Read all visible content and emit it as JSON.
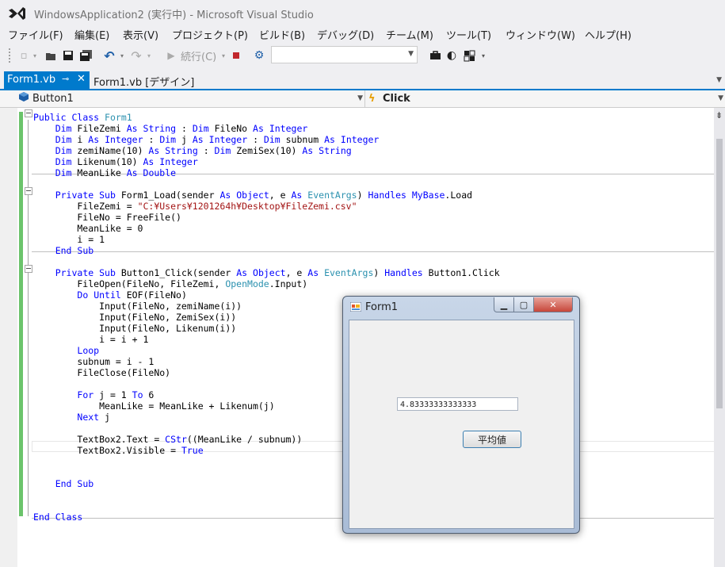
{
  "window": {
    "title": "WindowsApplication2 (実行中) - Microsoft Visual Studio"
  },
  "menu": [
    "ファイル(F)",
    "編集(E)",
    "表示(V)",
    "プロジェクト(P)",
    "ビルド(B)",
    "デバッグ(D)",
    "チーム(M)",
    "ツール(T)",
    "ウィンドウ(W)",
    "ヘルプ(H)"
  ],
  "toolbar": {
    "continue_label": "続行(C)",
    "configuration_value": ""
  },
  "tabs": {
    "active": "Form1.vb",
    "inactive": "Form1.vb [デザイン]"
  },
  "nav": {
    "object": "Button1",
    "event": "Click"
  },
  "code_lines": [
    "Public Class Form1",
    "    Dim FileZemi As String : Dim FileNo As Integer",
    "    Dim i As Integer : Dim j As Integer : Dim subnum As Integer",
    "    Dim zemiName(10) As String : Dim ZemiSex(10) As String",
    "    Dim Likenum(10) As Integer",
    "    Dim MeanLike As Double",
    "",
    "    Private Sub Form1_Load(sender As Object, e As EventArgs) Handles MyBase.Load",
    "        FileZemi = \"C:¥Users¥1201264h¥Desktop¥FileZemi.csv\"",
    "        FileNo = FreeFile()",
    "        MeanLike = 0",
    "        i = 1",
    "    End Sub",
    "",
    "    Private Sub Button1_Click(sender As Object, e As EventArgs) Handles Button1.Click",
    "        FileOpen(FileNo, FileZemi, OpenMode.Input)",
    "        Do Until EOF(FileNo)",
    "            Input(FileNo, zemiName(i))",
    "            Input(FileNo, ZemiSex(i))",
    "            Input(FileNo, Likenum(i))",
    "            i = i + 1",
    "        Loop",
    "        subnum = i - 1",
    "        FileClose(FileNo)",
    "",
    "        For j = 1 To 6",
    "            MeanLike = MeanLike + Likenum(j)",
    "        Next j",
    "",
    "        TextBox2.Text = CStr((MeanLike / subnum))",
    "        TextBox2.Visible = True",
    "",
    "",
    "    End Sub",
    "",
    "",
    "End Class"
  ],
  "keywords": [
    "Public",
    "Class",
    "Dim",
    "As",
    "String",
    "Integer",
    "Double",
    "Private",
    "Sub",
    "Object",
    "Handles",
    "MyBase",
    "End",
    "Do",
    "Until",
    "Loop",
    "For",
    "To",
    "Next",
    "CStr",
    "True"
  ],
  "types": [
    "Form1",
    "EventArgs",
    "OpenMode"
  ],
  "form1": {
    "title": "Form1",
    "textbox_value": "4.83333333333333",
    "button_label": "平均値"
  },
  "colors": {
    "accent": "#007acc",
    "keyword": "#0000ff",
    "type": "#2b91af",
    "string": "#a31515",
    "change_bar": "#6bc36b"
  }
}
